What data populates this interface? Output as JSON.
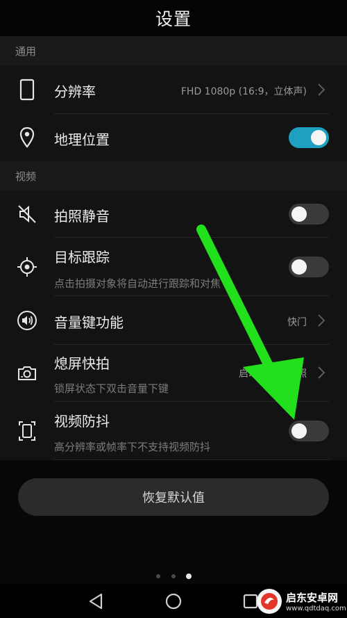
{
  "title": "设置",
  "sections": {
    "general": "通用",
    "video": "视频"
  },
  "rows": {
    "resolution": {
      "label": "分辨率",
      "value": "FHD 1080p (16:9，立体声)"
    },
    "location": {
      "label": "地理位置",
      "toggle_on": true
    },
    "shutter_mute": {
      "label": "拍照静音",
      "toggle_on": false
    },
    "object_tracking": {
      "label": "目标跟踪",
      "sub": "点击拍摄对象将自动进行跟踪和对焦",
      "toggle_on": false
    },
    "volume_key": {
      "label": "音量键功能",
      "value": "快门"
    },
    "snapshot": {
      "label": "熄屏快拍",
      "sub": "锁屏状态下双击音量下键",
      "value": "启动相机并拍照"
    },
    "stabilization": {
      "label": "视频防抖",
      "sub": "高分辨率或帧率下不支持视频防抖",
      "toggle_on": false
    }
  },
  "reset_button": "恢复默认值",
  "page_indicator": {
    "count": 3,
    "active": 3
  },
  "watermark": {
    "name": "启东安卓网",
    "url": "www.qdtdaq.com"
  },
  "colors": {
    "toggle_on": "#1ea1c0",
    "toggle_off": "#3a3a3a",
    "annotation_arrow": "#22e01c"
  },
  "icons": {
    "resolution": "phone-outline-icon",
    "location": "location-pin-icon",
    "shutter_mute": "mute-icon",
    "object_tracking": "crosshair-icon",
    "volume_key": "volume-icon",
    "snapshot": "camera-icon",
    "stabilization": "stabilization-icon"
  }
}
